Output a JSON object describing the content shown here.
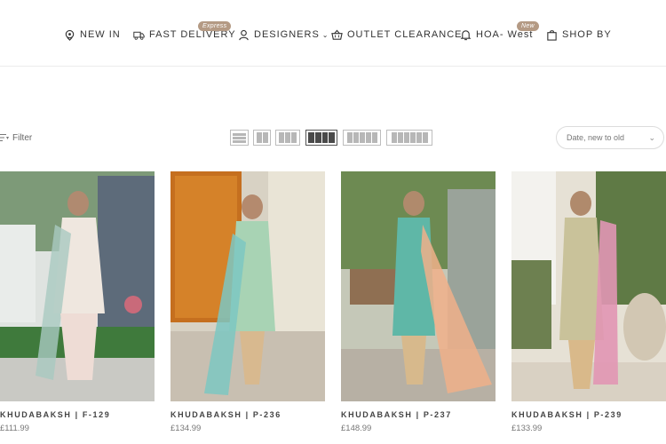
{
  "nav": {
    "items": [
      {
        "label": "NEW IN",
        "icon": "pin-icon"
      },
      {
        "label": "FAST DELIVERY",
        "icon": "truck-icon",
        "badge": "Express"
      },
      {
        "label": "DESIGNERS",
        "icon": "user-icon",
        "caret": "⌄"
      },
      {
        "label": "OUTLET CLEARANCE",
        "icon": "basket-icon"
      },
      {
        "label": "HOA- West",
        "icon": "bell-icon",
        "badge": "New"
      },
      {
        "label": "SHOP BY",
        "icon": "bag-icon"
      }
    ]
  },
  "toolbar": {
    "filter_label": "Filter",
    "sort_value": "Date, new to old",
    "active_view": 4
  },
  "products": [
    {
      "name": "KHUDABAKSH | F-129",
      "price": "£111.99"
    },
    {
      "name": "KHUDABAKSH | P-236",
      "price": "£134.99"
    },
    {
      "name": "KHUDABAKSH | P-237",
      "price": "£148.99"
    },
    {
      "name": "KHUDABAKSH | P-239",
      "price": "£133.99"
    }
  ]
}
